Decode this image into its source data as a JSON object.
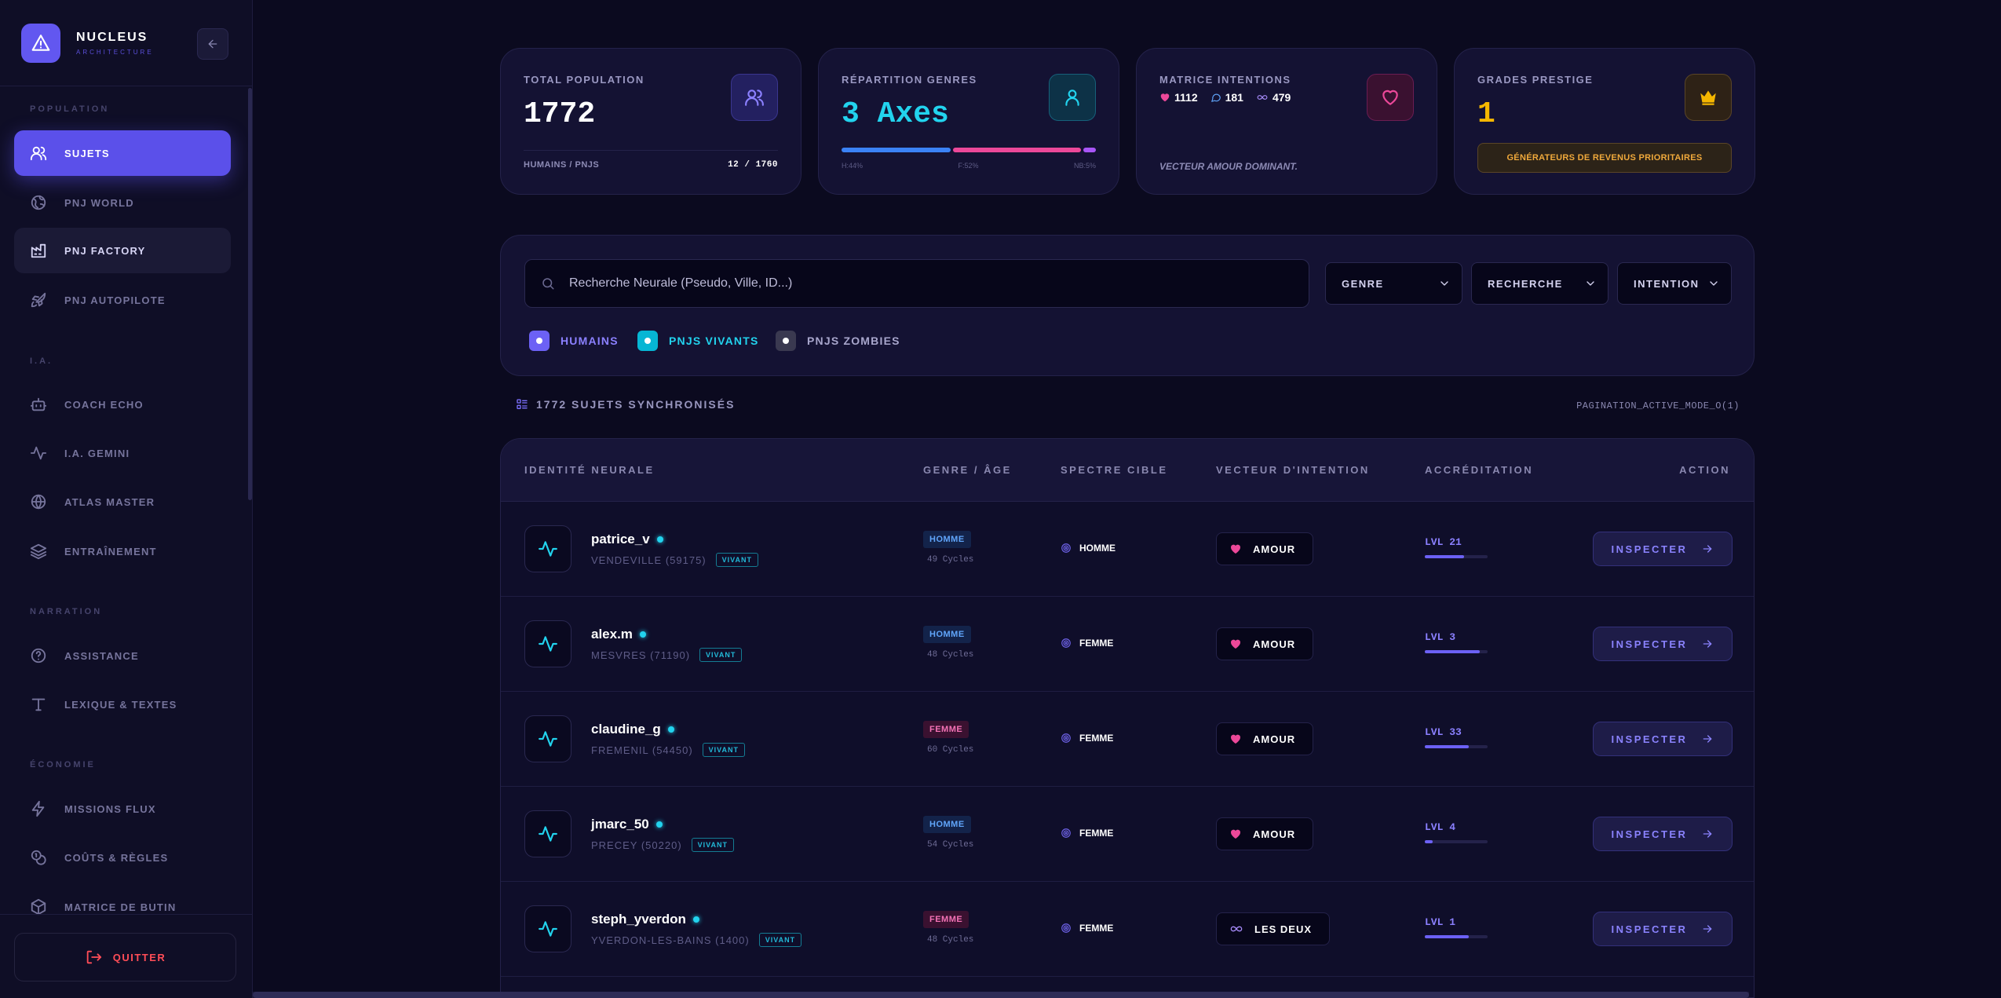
{
  "app": {
    "name": "NUCLEUS",
    "subtitle": "ARCHITECTURE"
  },
  "sidebar": {
    "sections": [
      {
        "label": "POPULATION"
      },
      {
        "label": "I.A."
      },
      {
        "label": "NARRATION"
      },
      {
        "label": "ÉCONOMIE"
      }
    ],
    "items": [
      {
        "label": "SUJETS",
        "icon": "users-icon"
      },
      {
        "label": "PNJ WORLD",
        "icon": "globe-icon"
      },
      {
        "label": "PNJ FACTORY",
        "icon": "factory-icon"
      },
      {
        "label": "PNJ AUTOPILOTE",
        "icon": "rocket-icon"
      },
      {
        "label": "COACH ECHO",
        "icon": "bot-icon"
      },
      {
        "label": "I.A. GEMINI",
        "icon": "activity-icon"
      },
      {
        "label": "ATLAS MASTER",
        "icon": "world-icon"
      },
      {
        "label": "ENTRAÎNEMENT",
        "icon": "layers-icon"
      },
      {
        "label": "ASSISTANCE",
        "icon": "help-icon"
      },
      {
        "label": "LEXIQUE & TEXTES",
        "icon": "text-icon"
      },
      {
        "label": "MISSIONS FLUX",
        "icon": "zap-icon"
      },
      {
        "label": "COÛTS & RÈGLES",
        "icon": "coins-icon"
      },
      {
        "label": "MATRICE DE BUTIN",
        "icon": "box-icon"
      }
    ],
    "quit_label": "QUITTER"
  },
  "stats": {
    "population": {
      "title": "TOTAL POPULATION",
      "value": "1772",
      "foot_label": "HUMAINS / PNJS",
      "foot_value": "12 / 1760"
    },
    "genres": {
      "title": "RÉPARTITION GENRES",
      "value": "3 Axes",
      "labels": [
        "H:44%",
        "F:52%",
        "NB:5%"
      ],
      "shares": [
        44,
        52,
        5
      ]
    },
    "intentions": {
      "title": "MATRICE INTENTIONS",
      "amour": "1112",
      "amitie": "181",
      "deux": "479",
      "footer": "VECTEUR AMOUR DOMINANT."
    },
    "prestige": {
      "title": "GRADES PRESTIGE",
      "value": "1",
      "badge": "GÉNÉRATEURS DE REVENUS PRIORITAIRES"
    }
  },
  "filters": {
    "search_placeholder": "Recherche Neurale (Pseudo, Ville, ID...)",
    "selects": [
      "GENRE",
      "RECHERCHE",
      "INTENTION"
    ],
    "chips": [
      "HUMAINS",
      "PNJS VIVANTS",
      "PNJS ZOMBIES"
    ]
  },
  "list": {
    "count_label": "1772 SUJETS SYNCHRONISÉS",
    "pagination": "PAGINATION_ACTIVE_MODE_O(1)"
  },
  "table": {
    "columns": [
      "IDENTITÉ NEURALE",
      "GENRE / ÂGE",
      "SPECTRE CIBLE",
      "VECTEUR D'INTENTION",
      "ACCRÉDITATION",
      "ACTION"
    ],
    "rows": [
      {
        "name": "patrice_v",
        "location": "VENDEVILLE (59175)",
        "status": "VIVANT",
        "genre": "HOMME",
        "age": "49 Cycles",
        "spectre": "HOMME",
        "intent": "AMOUR",
        "level": "LVL 21",
        "level_fill": 0.62,
        "action": "INSPECTER"
      },
      {
        "name": "alex.m",
        "location": "MESVRES (71190)",
        "status": "VIVANT",
        "genre": "HOMME",
        "age": "48 Cycles",
        "spectre": "FEMME",
        "intent": "AMOUR",
        "level": "LVL 3",
        "level_fill": 0.88,
        "action": "INSPECTER"
      },
      {
        "name": "claudine_g",
        "location": "FREMENIL (54450)",
        "status": "VIVANT",
        "genre": "FEMME",
        "age": "60 Cycles",
        "spectre": "FEMME",
        "intent": "AMOUR",
        "level": "LVL 33",
        "level_fill": 0.7,
        "action": "INSPECTER"
      },
      {
        "name": "jmarc_50",
        "location": "PRECEY (50220)",
        "status": "VIVANT",
        "genre": "HOMME",
        "age": "54 Cycles",
        "spectre": "FEMME",
        "intent": "AMOUR",
        "level": "LVL 4",
        "level_fill": 0.12,
        "action": "INSPECTER"
      },
      {
        "name": "steph_yverdon",
        "location": "YVERDON-LES-BAINS (1400)",
        "status": "VIVANT",
        "genre": "FEMME",
        "age": "48 Cycles",
        "spectre": "FEMME",
        "intent": "LES DEUX",
        "level": "LVL 1",
        "level_fill": 0.7,
        "action": "INSPECTER"
      }
    ]
  },
  "colors": {
    "accent": "#5b50ea",
    "cyan": "#22d3ee",
    "pink": "#ec4899",
    "gold": "#f5b700",
    "danger": "#ff4d57"
  }
}
